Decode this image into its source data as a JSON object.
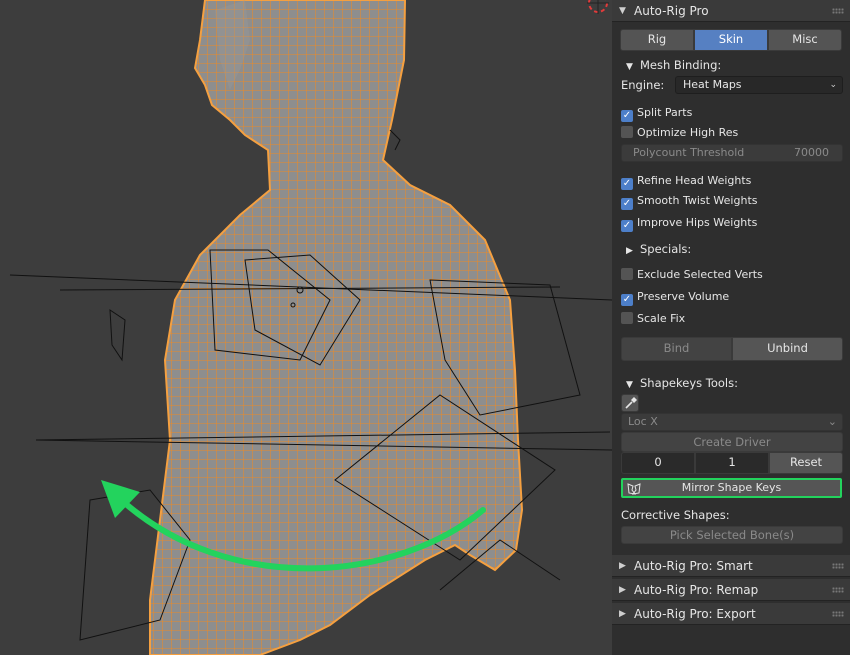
{
  "panel_title": "Auto-Rig Pro",
  "tabs": [
    {
      "label": "Rig",
      "active": false
    },
    {
      "label": "Skin",
      "active": true
    },
    {
      "label": "Misc",
      "active": false
    }
  ],
  "mesh_binding": {
    "title": "Mesh Binding:",
    "engine_label": "Engine:",
    "engine_value": "Heat Maps",
    "split_parts": {
      "label": "Split Parts",
      "checked": true
    },
    "optimize_high_res": {
      "label": "Optimize High Res",
      "checked": false
    },
    "polycount_threshold": {
      "label": "Polycount Threshold",
      "value": "70000"
    },
    "refine_head_weights": {
      "label": "Refine Head Weights",
      "checked": true
    },
    "smooth_twist_weights": {
      "label": "Smooth Twist Weights",
      "checked": true
    },
    "improve_hips_weights": {
      "label": "Improve Hips Weights",
      "checked": true
    }
  },
  "specials": {
    "title": "Specials:",
    "exclude_selected_verts": {
      "label": "Exclude Selected Verts",
      "checked": false
    },
    "preserve_volume": {
      "label": "Preserve Volume",
      "checked": true
    },
    "scale_fix": {
      "label": "Scale Fix",
      "checked": false
    }
  },
  "bind_buttons": {
    "bind": "Bind",
    "unbind": "Unbind"
  },
  "shapekeys": {
    "title": "Shapekeys Tools:",
    "loc_dropdown": "Loc X",
    "create_driver": "Create Driver",
    "value_0": "0",
    "value_1": "1",
    "reset": "Reset",
    "mirror_shape_keys": "Mirror Shape Keys",
    "corrective_shapes_label": "Corrective Shapes:",
    "pick_selected_bones": "Pick Selected Bone(s)"
  },
  "collapsed_panels": [
    "Auto-Rig Pro: Smart",
    "Auto-Rig Pro: Remap",
    "Auto-Rig Pro: Export"
  ],
  "colors": {
    "highlight": "#23d35d",
    "mesh_wire": "#f0902a",
    "active_tab": "#5680c2"
  }
}
